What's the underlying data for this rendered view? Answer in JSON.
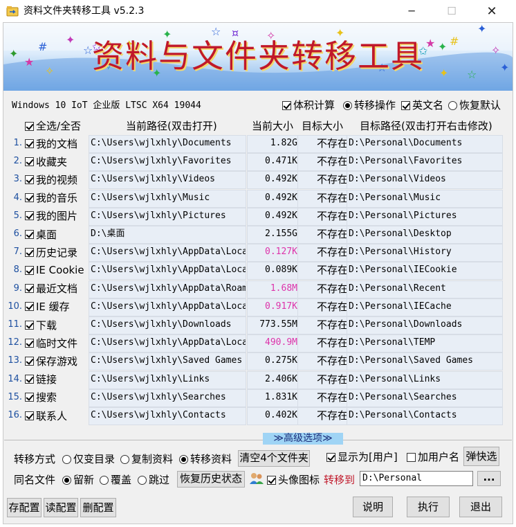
{
  "window": {
    "title": "资料文件夹转移工具 v5.2.3"
  },
  "banner": {
    "title": "资料与文件夹转移工具"
  },
  "os_info": "Windows 10 IoT 企业版 LTSC  X64 19044",
  "options": {
    "size_calc": "体积计算",
    "transfer_op": "转移操作",
    "english_name": "英文名",
    "restore_default": "恢复默认"
  },
  "table": {
    "headers": {
      "select_all": "全选/全否",
      "current_path": "当前路径(双击打开)",
      "current_size": "当前大小",
      "target_size": "目标大小",
      "target_path": "目标路径(双击打开右击修改)"
    },
    "rows": [
      {
        "idx": "1.",
        "name": "我的文档",
        "path": "C:\\Users\\wjlxhly\\Documents",
        "size": "1.82G",
        "tsize": "不存在",
        "tpath": "D:\\Personal\\Documents",
        "pink": false
      },
      {
        "idx": "2.",
        "name": "收藏夹",
        "path": "C:\\Users\\wjlxhly\\Favorites",
        "size": "0.471K",
        "tsize": "不存在",
        "tpath": "D:\\Personal\\Favorites",
        "pink": false
      },
      {
        "idx": "3.",
        "name": "我的视频",
        "path": "C:\\Users\\wjlxhly\\Videos",
        "size": "0.492K",
        "tsize": "不存在",
        "tpath": "D:\\Personal\\Videos",
        "pink": false
      },
      {
        "idx": "4.",
        "name": "我的音乐",
        "path": "C:\\Users\\wjlxhly\\Music",
        "size": "0.492K",
        "tsize": "不存在",
        "tpath": "D:\\Personal\\Music",
        "pink": false
      },
      {
        "idx": "5.",
        "name": "我的图片",
        "path": "C:\\Users\\wjlxhly\\Pictures",
        "size": "0.492K",
        "tsize": "不存在",
        "tpath": "D:\\Personal\\Pictures",
        "pink": false
      },
      {
        "idx": "6.",
        "name": "桌面",
        "path": "D:\\桌面",
        "size": "2.155G",
        "tsize": "不存在",
        "tpath": "D:\\Personal\\Desktop",
        "pink": false
      },
      {
        "idx": "7.",
        "name": "历史记录",
        "path": "C:\\Users\\wjlxhly\\AppData\\Local",
        "size": "0.127K",
        "tsize": "不存在",
        "tpath": "D:\\Personal\\History",
        "pink": true
      },
      {
        "idx": "8.",
        "name": "IE Cookie",
        "path": "C:\\Users\\wjlxhly\\AppData\\Local",
        "size": "0.089K",
        "tsize": "不存在",
        "tpath": "D:\\Personal\\IECookie",
        "pink": false
      },
      {
        "idx": "9.",
        "name": "最近文档",
        "path": "C:\\Users\\wjlxhly\\AppData\\Roami",
        "size": "1.68M",
        "tsize": "不存在",
        "tpath": "D:\\Personal\\Recent",
        "pink": true
      },
      {
        "idx": "10.",
        "name": "IE 缓存",
        "path": "C:\\Users\\wjlxhly\\AppData\\Local",
        "size": "0.917K",
        "tsize": "不存在",
        "tpath": "D:\\Personal\\IECache",
        "pink": true
      },
      {
        "idx": "11.",
        "name": "下载",
        "path": "C:\\Users\\wjlxhly\\Downloads",
        "size": "773.55M",
        "tsize": "不存在",
        "tpath": "D:\\Personal\\Downloads",
        "pink": false
      },
      {
        "idx": "12.",
        "name": "临时文件",
        "path": "C:\\Users\\wjlxhly\\AppData\\Local",
        "size": "490.9M",
        "tsize": "不存在",
        "tpath": "D:\\Personal\\TEMP",
        "pink": true
      },
      {
        "idx": "13.",
        "name": "保存游戏",
        "path": "C:\\Users\\wjlxhly\\Saved Games",
        "size": "0.275K",
        "tsize": "不存在",
        "tpath": "D:\\Personal\\Saved Games",
        "pink": false
      },
      {
        "idx": "14.",
        "name": "链接",
        "path": "C:\\Users\\wjlxhly\\Links",
        "size": "2.406K",
        "tsize": "不存在",
        "tpath": "D:\\Personal\\Links",
        "pink": false
      },
      {
        "idx": "15.",
        "name": "搜索",
        "path": "C:\\Users\\wjlxhly\\Searches",
        "size": "1.831K",
        "tsize": "不存在",
        "tpath": "D:\\Personal\\Searches",
        "pink": false
      },
      {
        "idx": "16.",
        "name": "联系人",
        "path": "C:\\Users\\wjlxhly\\Contacts",
        "size": "0.402K",
        "tsize": "不存在",
        "tpath": "D:\\Personal\\Contacts",
        "pink": false
      }
    ]
  },
  "advanced": {
    "label": "≫高级选项≫"
  },
  "transfer": {
    "label": "转移方式",
    "only_dir": "仅变目录",
    "copy": "复制资料",
    "move": "转移资料",
    "clear_btn": "清空4个文件夹",
    "show_as_user": "显示为[用户]",
    "add_username": "加用户名",
    "popup_btn": "弹快选"
  },
  "same_name": {
    "label": "同名文件",
    "keep_new": "留新",
    "overwrite": "覆盖",
    "skip": "跳过",
    "restore_btn": "恢复历史状态",
    "avatar_icon": "头像图标",
    "move_to": "转移到",
    "dest_value": "D:\\Personal",
    "browse": "..."
  },
  "footer": {
    "save_cfg": "存配置",
    "read_cfg": "读配置",
    "del_cfg": "删配置",
    "help": "说明",
    "execute": "执行",
    "exit": "退出"
  },
  "colors": {
    "banner_title": "#c0182a",
    "pink_size": "#dd33aa",
    "index_blue": "#1e50a0",
    "move_to_red": "#c0182a"
  }
}
